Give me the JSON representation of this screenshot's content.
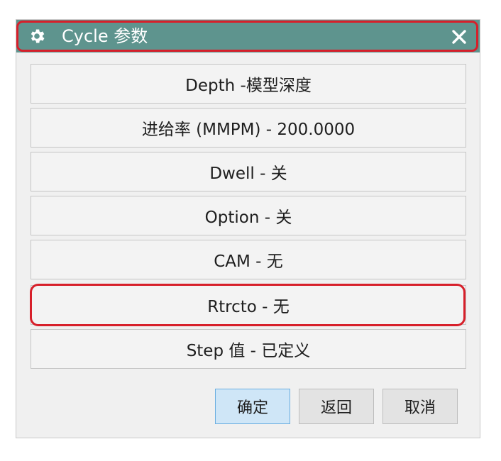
{
  "dialog": {
    "title": "Cycle 参数",
    "icon": "gear-icon",
    "close_icon": "close-icon"
  },
  "options": [
    {
      "label": "Depth -模型深度"
    },
    {
      "label": "进给率 (MMPM) - 200.0000"
    },
    {
      "label": "Dwell - 关"
    },
    {
      "label": "Option - 关"
    },
    {
      "label": "CAM - 无"
    },
    {
      "label": "Rtrcto - 无"
    },
    {
      "label": "Step 值 - 已定义"
    }
  ],
  "buttons": {
    "ok": "确定",
    "back": "返回",
    "cancel": "取消"
  },
  "colors": {
    "titlebar": "#5e948e",
    "highlight": "#d71f2a",
    "ok_button": "#cfe6f7"
  }
}
